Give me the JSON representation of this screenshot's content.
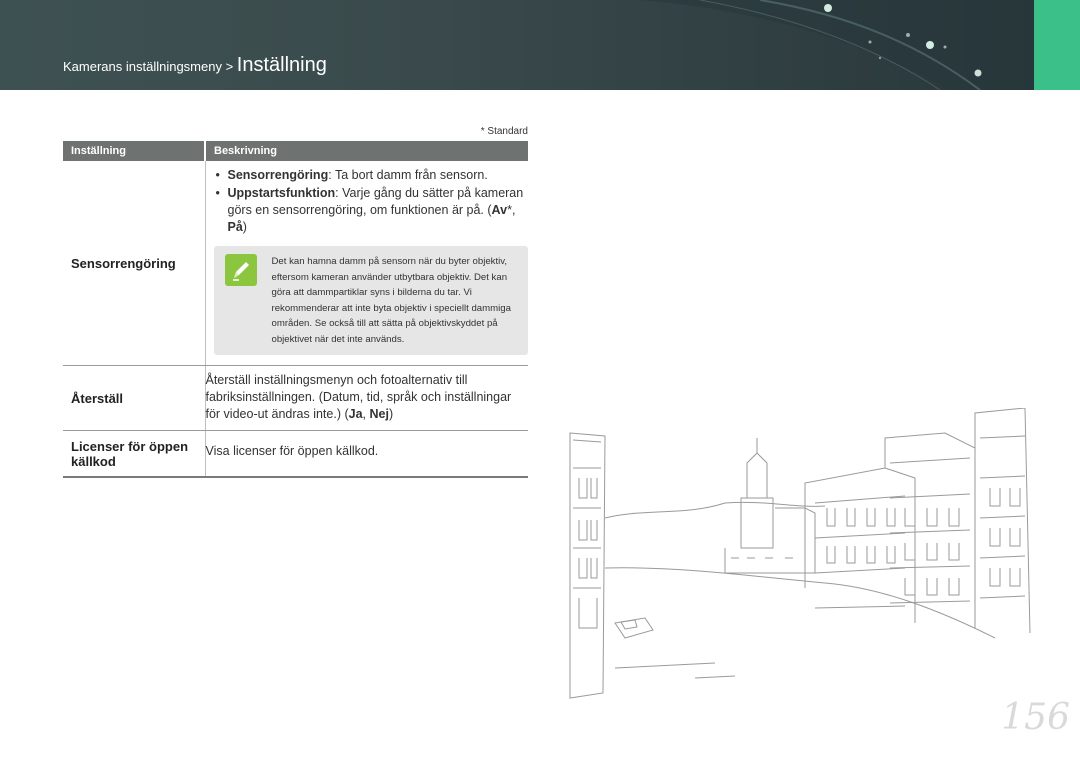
{
  "header": {
    "breadcrumb_parent": "Kamerans inställningsmeny > ",
    "breadcrumb_current": "Inställning",
    "background_color": "#3a4a4c",
    "tab_color": "#3cc08a"
  },
  "standard_note": "* Standard",
  "table": {
    "col_setting": "Inställning",
    "col_description": "Beskrivning",
    "rows": {
      "sensor": {
        "name": "Sensorrengöring",
        "bullet1_term": "Sensorrengöring",
        "bullet1_rest": ": Ta bort damm från sensorn.",
        "bullet2_term": "Uppstartsfunktion",
        "bullet2_rest": ": Varje gång du sätter på kameran görs en sensorrengöring, om funktionen är på. (",
        "bullet2_opt1": "Av",
        "bullet2_star": "*",
        "bullet2_sep": ", ",
        "bullet2_opt2": "På",
        "bullet2_end": ")",
        "note_text": "Det kan hamna damm på sensorn när du byter objektiv, eftersom kameran använder utbytbara objektiv. Det kan göra att dammpartiklar syns i bilderna du tar. Vi rekommenderar att inte byta objektiv i speciellt dammiga områden. Se också till att sätta på objektivskyddet på objektivet när det inte används.",
        "note_icon": "pen-icon"
      },
      "reset": {
        "name": "Återställ",
        "desc": "Återställ inställningsmenyn och fotoalternativ till fabriksinställningen. (Datum, tid, språk och inställningar för video-ut ändras inte.) (",
        "opt1": "Ja",
        "sep": ", ",
        "opt2": "Nej",
        "end": ")"
      },
      "license": {
        "name_line1": "Licenser för öppen",
        "name_line2": "källkod",
        "desc": "Visa licenser för öppen källkod."
      }
    }
  },
  "page_number": "156"
}
